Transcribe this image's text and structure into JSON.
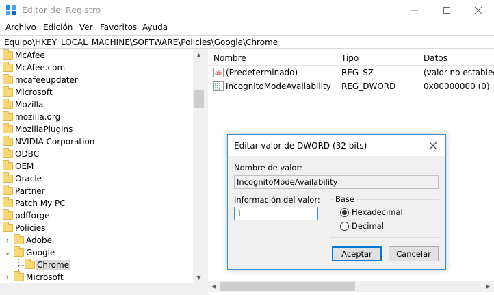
{
  "window": {
    "title": "Editor del Registro"
  },
  "menu": [
    "Archivo",
    "Edición",
    "Ver",
    "Favoritos",
    "Ayuda"
  ],
  "address": "Equipo\\HKEY_LOCAL_MACHINE\\SOFTWARE\\Policies\\Google\\Chrome",
  "tree": {
    "items": [
      {
        "label": "McAfee"
      },
      {
        "label": "McAfee.com"
      },
      {
        "label": "mcafeeupdater"
      },
      {
        "label": "Microsoft"
      },
      {
        "label": "Mozilla"
      },
      {
        "label": "mozilla.org"
      },
      {
        "label": "MozillaPlugins"
      },
      {
        "label": "NVIDIA Corporation"
      },
      {
        "label": "ODBC"
      },
      {
        "label": "OEM"
      },
      {
        "label": "Oracle"
      },
      {
        "label": "Partner"
      },
      {
        "label": "Patch My PC"
      },
      {
        "label": "pdfforge"
      },
      {
        "label": "Policies"
      }
    ],
    "policies_children": [
      {
        "label": "Adobe",
        "expander": "›"
      },
      {
        "label": "Google",
        "expander": "⌄"
      },
      {
        "label": "Chrome",
        "selected": true
      },
      {
        "label": "Microsoft",
        "expander": "›"
      }
    ]
  },
  "list": {
    "columns": [
      "Nombre",
      "Tipo",
      "Datos"
    ],
    "rows": [
      {
        "name": "(Predeterminado)",
        "type": "REG_SZ",
        "data": "(valor no establecido)",
        "icon": "string-value-icon"
      },
      {
        "name": "IncognitoModeAvailability",
        "type": "REG_DWORD",
        "data": "0x00000000 (0)",
        "icon": "binary-value-icon"
      }
    ]
  },
  "dialog": {
    "title": "Editar valor de DWORD (32 bits)",
    "value_name_label": "Nombre de valor:",
    "value_name": "IncognitoModeAvailability",
    "value_data_label": "Información del valor:",
    "value_data": "1",
    "base_label": "Base",
    "base_options": [
      {
        "label": "Hexadecimal",
        "checked": true
      },
      {
        "label": "Decimal",
        "checked": false
      }
    ],
    "ok_label": "Aceptar",
    "cancel_label": "Cancelar"
  },
  "colors": {
    "accent": "#0078d7",
    "folder": "#f8d775",
    "selection": "#d9d9d9"
  }
}
